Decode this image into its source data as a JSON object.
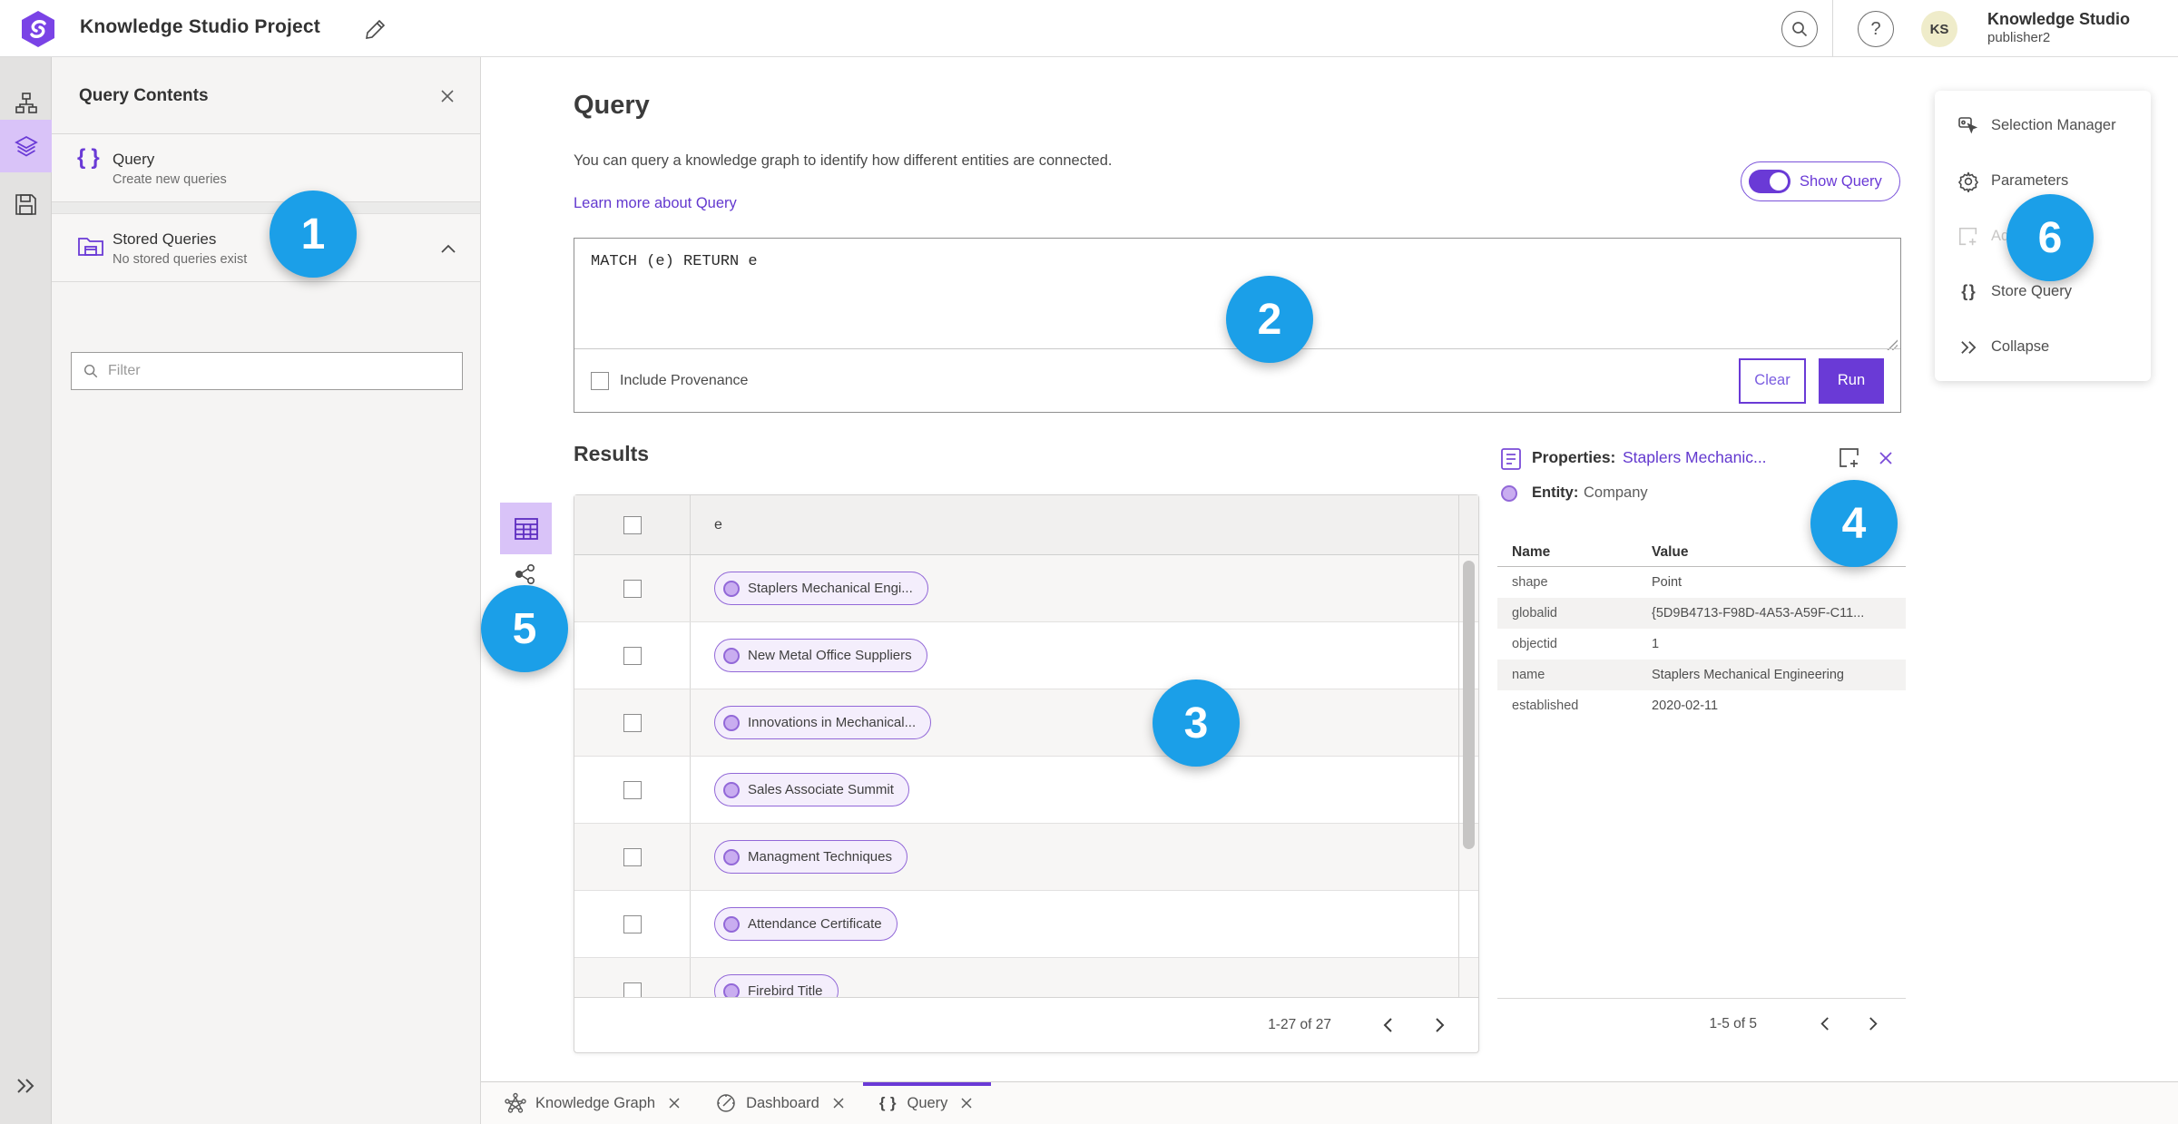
{
  "header": {
    "title": "Knowledge Studio Project",
    "account_name": "Knowledge Studio",
    "account_user": "publisher2",
    "avatar_initials": "KS"
  },
  "contents_panel": {
    "title": "Query Contents",
    "query_item": {
      "label": "Query",
      "sub": "Create new queries"
    },
    "stored_item": {
      "label": "Stored Queries",
      "sub": "No stored queries exist"
    },
    "filter_placeholder": "Filter"
  },
  "query": {
    "heading": "Query",
    "description": "You can query a knowledge graph to identify how different entities are connected.",
    "learn_more": "Learn more about Query",
    "show_query_label": "Show Query",
    "code": "MATCH (e) RETURN e",
    "include_provenance": "Include Provenance",
    "clear_label": "Clear",
    "run_label": "Run"
  },
  "results": {
    "heading": "Results",
    "column": "e",
    "rows": [
      "Staplers Mechanical Engi...",
      "New Metal Office Suppliers",
      "Innovations in Mechanical...",
      "Sales Associate Summit",
      "Managment Techniques",
      "Attendance Certificate",
      "Firebird Title"
    ],
    "pagination": "1-27 of 27"
  },
  "properties": {
    "label": "Properties:",
    "entity_link": "Staplers Mechanic...",
    "entity_label": "Entity:",
    "entity_type": "Company",
    "col_name": "Name",
    "col_value": "Value",
    "rows": [
      {
        "name": "shape",
        "value": "Point"
      },
      {
        "name": "globalid",
        "value": "{5D9B4713-F98D-4A53-A59F-C11..."
      },
      {
        "name": "objectid",
        "value": "1"
      },
      {
        "name": "name",
        "value": "Staplers Mechanical Engineering"
      },
      {
        "name": "established",
        "value": "2020-02-11"
      }
    ],
    "pagination": "1-5 of 5"
  },
  "actions_menu": {
    "items": [
      {
        "label": "Selection Manager"
      },
      {
        "label": "Parameters"
      },
      {
        "label": "Ad"
      },
      {
        "label": "Store Query"
      },
      {
        "label": "Collapse"
      }
    ]
  },
  "tabs": [
    {
      "label": "Knowledge Graph"
    },
    {
      "label": "Dashboard"
    },
    {
      "label": "Query"
    }
  ],
  "badges": [
    "1",
    "2",
    "3",
    "4",
    "5",
    "6"
  ],
  "colors": {
    "accent_purple": "#6a3ad6",
    "badge_blue": "#1b9fe8",
    "pill_fill": "#f4eefc",
    "pill_border": "#9268d8",
    "rail_selected": "#d9c3f8"
  }
}
